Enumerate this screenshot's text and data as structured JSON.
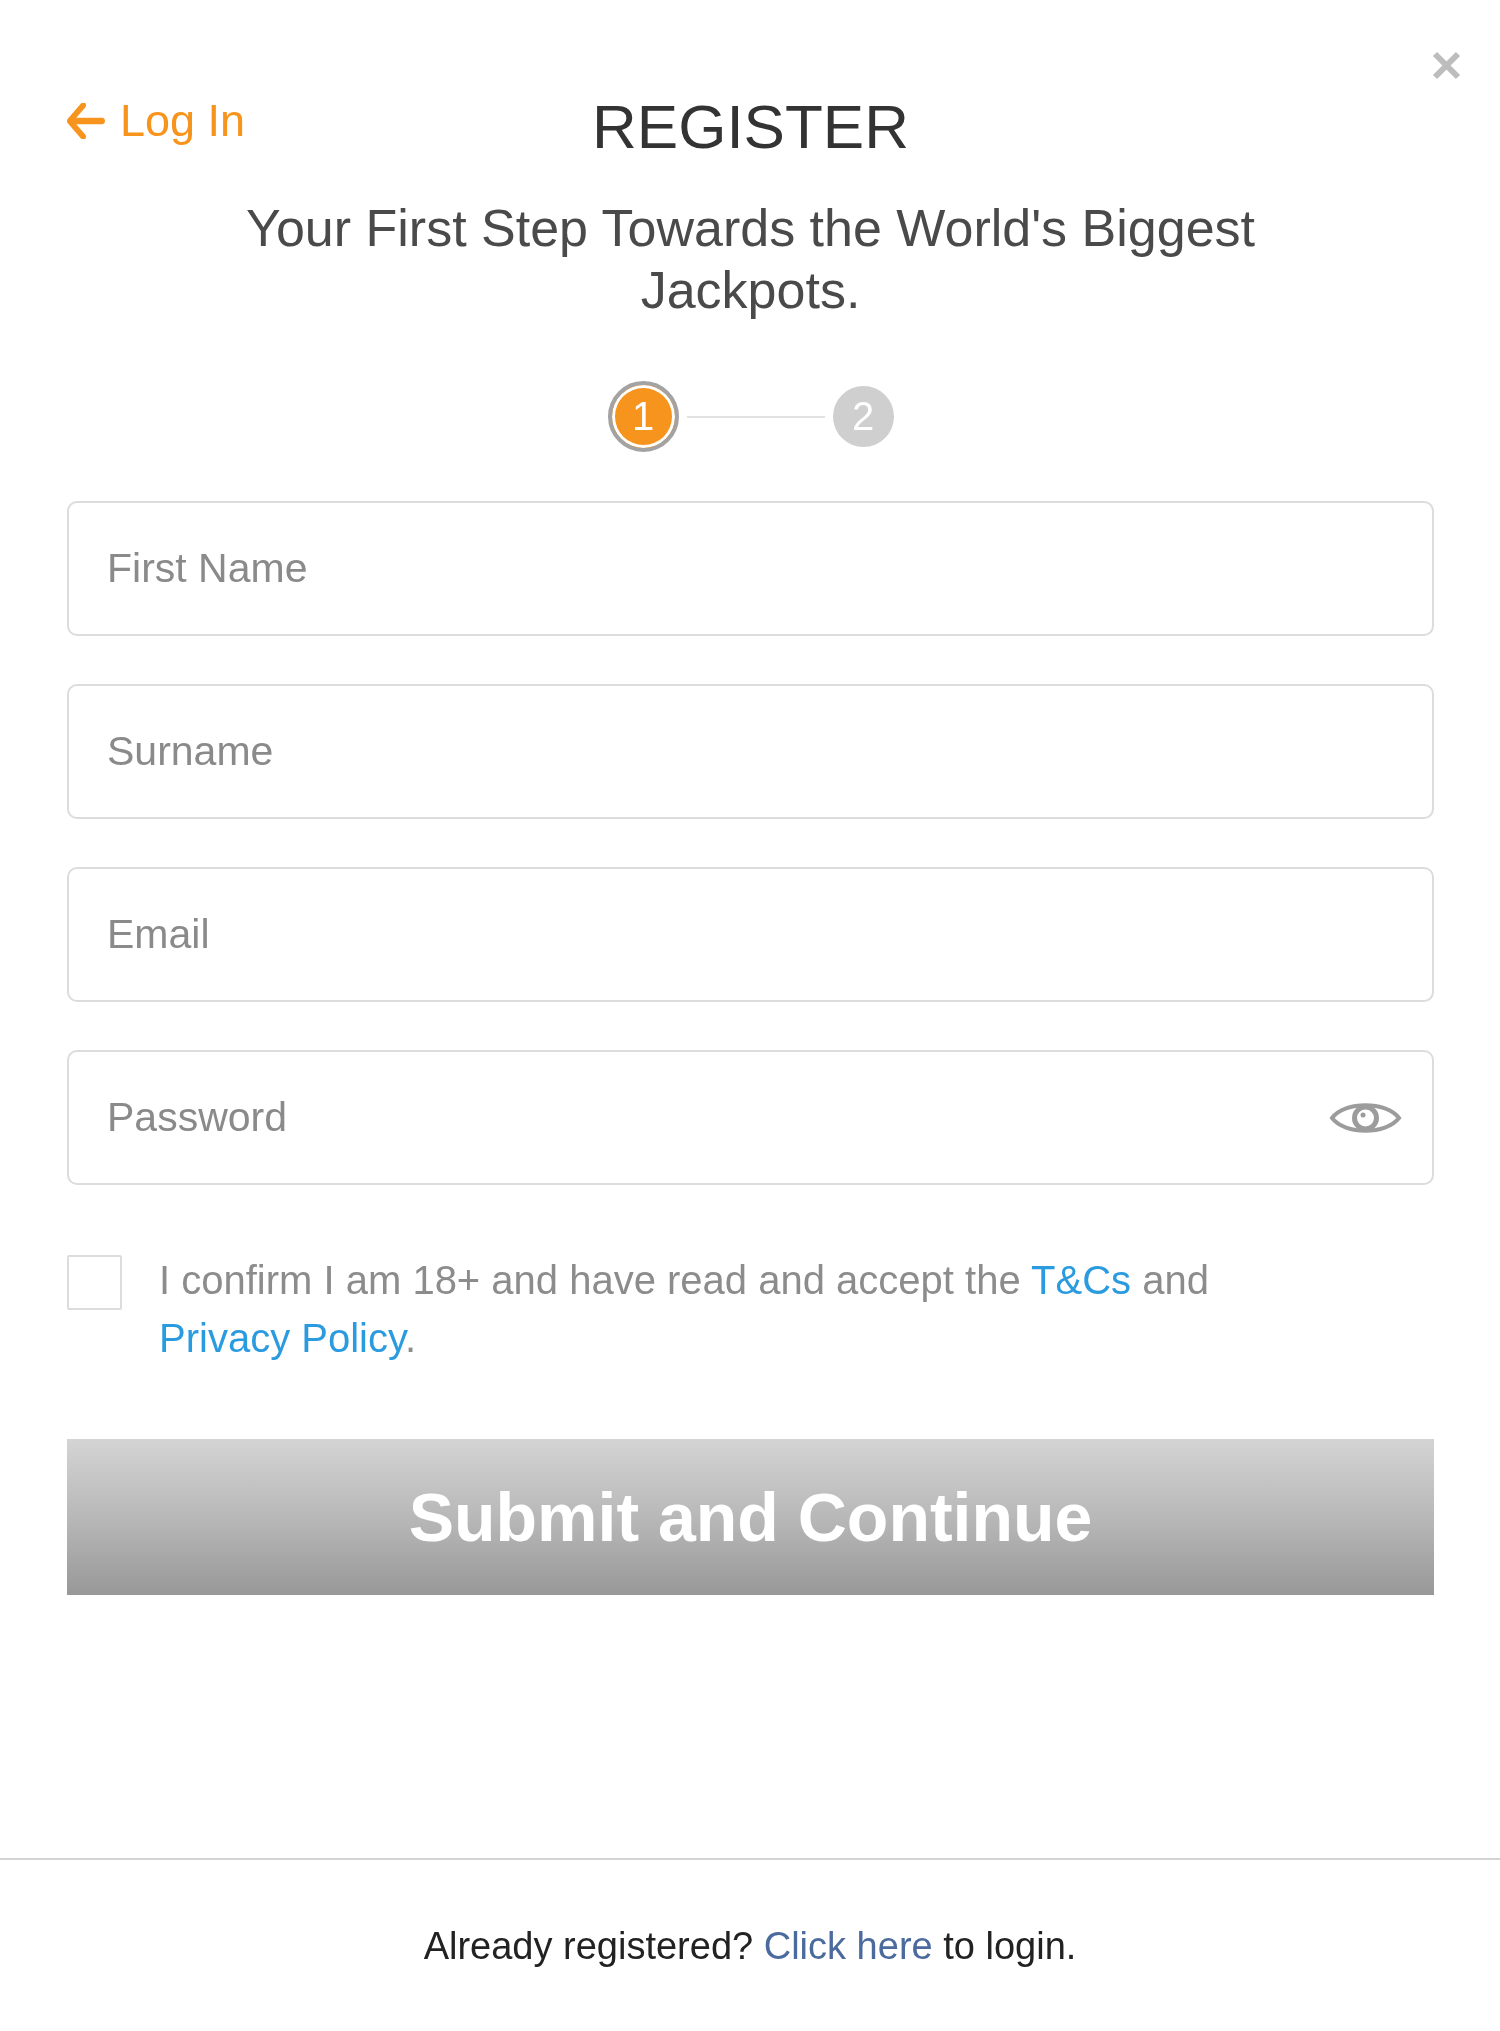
{
  "header": {
    "back_link": "Log In",
    "title": "REGISTER"
  },
  "subtitle": "Your First Step Towards the World's Biggest Jackpots.",
  "steps": [
    {
      "label": "1",
      "selected": true
    },
    {
      "label": "2",
      "selected": false
    }
  ],
  "fields": [
    {
      "kind": "text",
      "placeholder": "First Name"
    },
    {
      "kind": "text",
      "placeholder": "Surname"
    },
    {
      "kind": "text",
      "placeholder": "Email"
    },
    {
      "kind": "password",
      "placeholder": "Password"
    }
  ],
  "consent": {
    "checked": false,
    "parts": [
      {
        "kind": "text",
        "text": "I confirm I am 18+ and have read and accept the "
      },
      {
        "kind": "link",
        "text": "T&Cs"
      },
      {
        "kind": "text",
        "text": " and "
      },
      {
        "kind": "link",
        "text": "Privacy Policy"
      },
      {
        "kind": "text",
        "text": "."
      }
    ]
  },
  "submit": {
    "label": "Submit and Continue",
    "disabled": true
  },
  "footer": {
    "parts": [
      {
        "kind": "text",
        "text": "Already registered? "
      },
      {
        "kind": "link",
        "text": "Click here"
      },
      {
        "kind": "text",
        "text": " to login."
      }
    ]
  }
}
